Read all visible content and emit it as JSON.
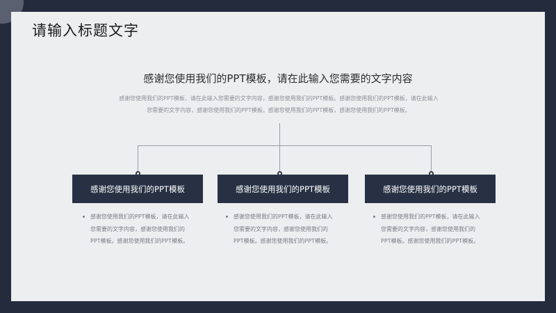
{
  "title": "请输入标题文字",
  "subtitle": "感谢您使用我们的PPT模板，请在此输入您需要的文字内容",
  "intro": "感谢您使用我们的PPT模板，请在此输入您需要的文字内容，感谢您使用我们的PPT模板。感谢您使用我们的PPT模板，请在此输入您需要的文字内容，感谢您使用我们的PPT模板。感谢您使用我们的PPT模板，感谢您使用我们的PPT模板。",
  "cards": [
    {
      "label": "感谢您使用我们的PPT模板",
      "text": "感谢您使用我们的PPT模板，请在此输入您需要的文字内容，感谢您使用我们的PPT模板。感谢您使用我们的PPT模板。"
    },
    {
      "label": "感谢您使用我们的PPT模板",
      "text": "感谢您使用我们的PPT模板，请在此输入您需要的文字内容，感谢您使用我们的PPT模板。感谢您使用我们的PPT模板。"
    },
    {
      "label": "感谢您使用我们的PPT模板",
      "text": "感谢您使用我们的PPT模板，请在此输入您需要的文字内容，感谢您使用我们的PPT模板。感谢您使用我们的PPT模板。"
    }
  ]
}
